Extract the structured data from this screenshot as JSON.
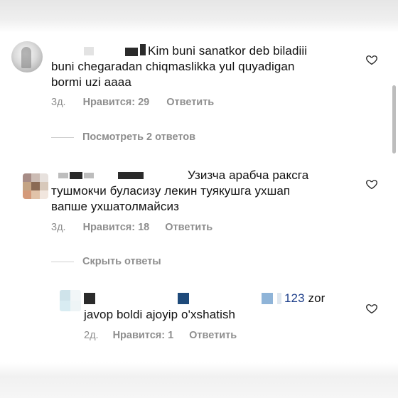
{
  "comments": [
    {
      "text_line1": "Kim buni sanatkor deb biladiii",
      "text_line2": "buni chegaradan chiqmaslikka yul quyadigan",
      "text_line3": "bormi uzi aaaa",
      "time": "3д.",
      "likes": "Нравится: 29",
      "reply": "Ответить"
    },
    {
      "text_line1": "Узизча арабча раксга",
      "text_line2": "тушмокчи буласизу лекин туякушга ухшап",
      "text_line3": "вапше ухшатолмайсиз",
      "time": "3д.",
      "likes": "Нравится: 18",
      "reply": "Ответить"
    },
    {
      "text_mention": "123",
      "text_line1_tail": " zor",
      "text_line2": "javop boldi ajoyip o'xshatish",
      "time": "2д.",
      "likes": "Нравится: 1",
      "reply": "Ответить"
    }
  ],
  "threads": {
    "view_replies": "Посмотреть 2 ответов",
    "hide_replies": "Скрыть ответы"
  },
  "icons": {
    "like": "heart-outline-icon"
  },
  "colors": {
    "meta": "#8e8e8e",
    "mention": "#1e3f8a"
  }
}
